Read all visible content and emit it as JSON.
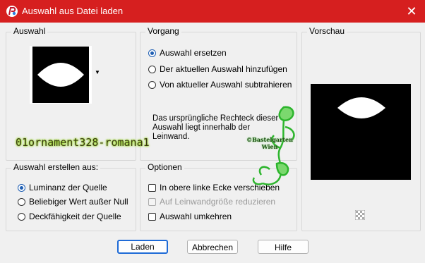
{
  "window": {
    "title": "Auswahl aus Datei laden",
    "close_glyph": "✕"
  },
  "auswahl": {
    "legend": "Auswahl"
  },
  "vorgang": {
    "legend": "Vorgang",
    "options": [
      {
        "label": "Auswahl ersetzen",
        "selected": true
      },
      {
        "label": "Der aktuellen Auswahl hinzufügen",
        "selected": false
      },
      {
        "label": "Von aktueller Auswahl subtrahieren",
        "selected": false
      }
    ],
    "info": "Das ursprüngliche Rechteck dieser Auswahl liegt innerhalb der Leinwand."
  },
  "vorschau": {
    "legend": "Vorschau"
  },
  "erstellen": {
    "legend": "Auswahl erstellen aus:",
    "options": [
      {
        "label": "Luminanz der Quelle",
        "selected": true
      },
      {
        "label": "Beliebiger Wert außer Null",
        "selected": false
      },
      {
        "label": "Deckfähigkeit der Quelle",
        "selected": false
      }
    ]
  },
  "optionen": {
    "legend": "Optionen",
    "items": [
      {
        "label": "In obere linke Ecke verschieben",
        "checked": false,
        "enabled": true
      },
      {
        "label": "Auf Leinwandgröße reduzieren",
        "checked": false,
        "enabled": false
      },
      {
        "label": "Auswahl umkehren",
        "checked": false,
        "enabled": true
      }
    ]
  },
  "buttons": {
    "load": "Laden",
    "cancel": "Abbrechen",
    "help": "Hilfe"
  },
  "watermark": {
    "name": "01ornament328-romana1",
    "stamp_lines": [
      "©Bastelgarten",
      "Wien"
    ]
  },
  "colors": {
    "titlebar": "#d61f1f",
    "accent": "#1e5eb3",
    "watermark_green": "#2db52d"
  }
}
